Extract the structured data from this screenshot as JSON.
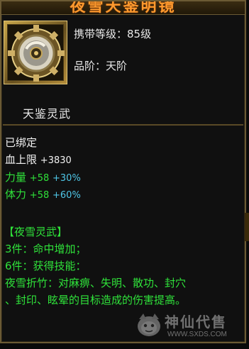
{
  "title": "夜雪天鉴明镜",
  "item": {
    "icon": "mirror-gear-icon"
  },
  "meta": {
    "carry_level": "携带等级：85级",
    "grade": "品阶：天阶"
  },
  "subtitle": "天鉴灵武",
  "stats": {
    "bound": "已绑定",
    "hp_label": "血上限",
    "hp_value": "+3830",
    "str_label": "力量",
    "str_value": "+58",
    "str_pct": "+30%",
    "con_label": "体力",
    "con_value": "+58",
    "con_pct": "+60%"
  },
  "set": {
    "name": "【夜雪灵武】",
    "bonus3": "3件：命中增加；",
    "bonus6": "6件：获得技能：",
    "skill_line1": "夜雪折竹：对麻痹、失明、散功、封穴",
    "skill_line2": "、封印、眩晕的目标造成的伤害提高。"
  },
  "watermark": {
    "cn": "神仙代售",
    "url": "WWW.SXDS.COM",
    "icon": "mascot-logo-icon"
  },
  "colors": {
    "title": "#ff9a2e",
    "set": "#2fe23a",
    "percent": "#4fc7e8",
    "skill": "#e6e83a"
  }
}
